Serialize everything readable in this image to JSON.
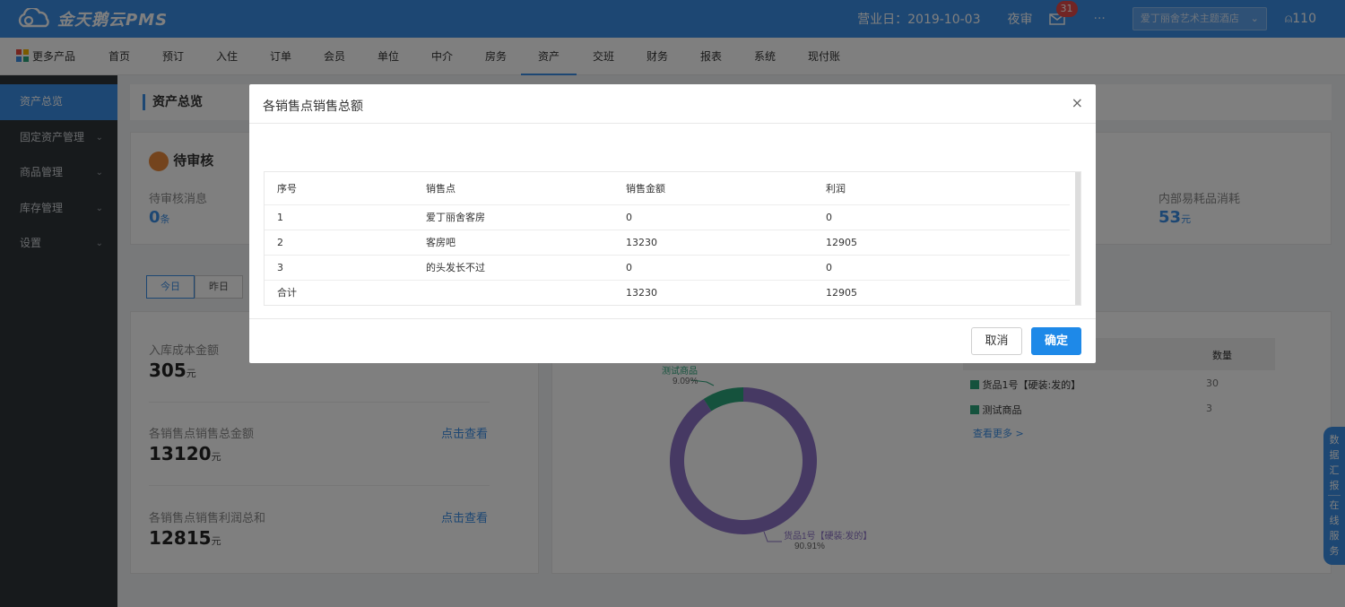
{
  "app": {
    "logo_text": "金天鹅云PMS"
  },
  "topbar": {
    "business_date": "营业日：2019-10-03",
    "night_audit": "夜审",
    "mail_badge": "31",
    "more": "···",
    "hotel_select": "爱丁丽舍艺术主题酒店",
    "user": "110"
  },
  "nav": {
    "more_products": "更多产品",
    "items": [
      "首页",
      "预订",
      "入住",
      "订单",
      "会员",
      "单位",
      "中介",
      "房务",
      "资产",
      "交班",
      "财务",
      "报表",
      "系统",
      "现付账"
    ],
    "active": "资产"
  },
  "sidebar": {
    "items": [
      {
        "label": "资产总览",
        "active": true,
        "arrow": ""
      },
      {
        "label": "固定资产管理",
        "active": false,
        "arrow": "⌄"
      },
      {
        "label": "商品管理",
        "active": false,
        "arrow": "⌄"
      },
      {
        "label": "库存管理",
        "active": false,
        "arrow": "⌄"
      },
      {
        "label": "设置",
        "active": false,
        "arrow": "⌄"
      }
    ]
  },
  "main": {
    "page_title": "资产总览",
    "pending": {
      "title": "待审核",
      "msg_label": "待审核消息",
      "msg_value": "0",
      "msg_unit": "条"
    },
    "consumables": {
      "label": "内部易耗品消耗",
      "value": "53",
      "unit": "元"
    },
    "tabs": [
      "今日",
      "昨日"
    ],
    "stats": [
      {
        "label": "入库成本金额",
        "value": "305",
        "unit": "元",
        "link": ""
      },
      {
        "label": "各销售点销售总金额",
        "value": "13120",
        "unit": "元",
        "link": "点击查看"
      },
      {
        "label": "各销售点销售利润总和",
        "value": "12815",
        "unit": "元",
        "link": "点击查看"
      }
    ],
    "donut": {
      "slices": [
        {
          "name": "测试商品",
          "percent": "9.09%",
          "value": 9.09,
          "color": "#2aa57a"
        },
        {
          "name": "货品1号【硬装:发的】",
          "percent": "90.91%",
          "value": 90.91,
          "color": "#8c73c6"
        }
      ]
    },
    "rank": {
      "qty_header": "数量",
      "rows": [
        {
          "name": "货品1号【硬装:发的】",
          "qty": "30"
        },
        {
          "name": "测试商品",
          "qty": "3"
        }
      ],
      "more": "查看更多 >"
    }
  },
  "modal": {
    "title": "各销售点销售总额",
    "close": "×",
    "columns": [
      "序号",
      "销售点",
      "销售金额",
      "利润"
    ],
    "rows": [
      [
        "1",
        "爱丁丽舍客房",
        "0",
        "0"
      ],
      [
        "2",
        "客房吧",
        "13230",
        "12905"
      ],
      [
        "3",
        "的头发长不过",
        "0",
        "0"
      ],
      [
        "合计",
        "",
        "13230",
        "12905"
      ]
    ],
    "cancel": "取消",
    "ok": "确定"
  },
  "float_service": {
    "top": [
      "数",
      "据",
      "汇",
      "报"
    ],
    "bottom": [
      "在",
      "线",
      "服",
      "务"
    ]
  }
}
